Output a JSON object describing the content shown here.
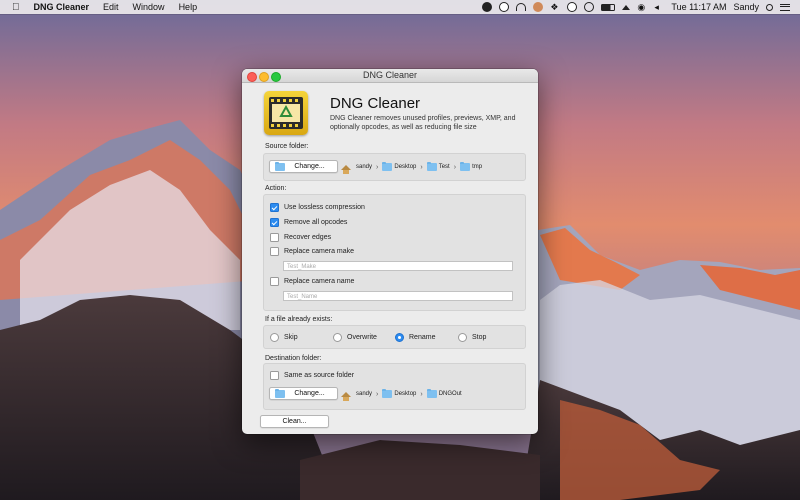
{
  "menubar": {
    "app_name": "DNG Cleaner",
    "menus": [
      "Edit",
      "Window",
      "Help"
    ],
    "time": "Tue 11:17 AM",
    "user": "Sandy",
    "status_icons": [
      "circle-icon",
      "info-icon",
      "headphones-icon",
      "avatar-icon",
      "dropbox-icon",
      "time-machine-icon",
      "timer-icon",
      "battery-icon",
      "eject-icon",
      "wifi-icon",
      "volume-icon"
    ]
  },
  "window": {
    "title": "DNG Cleaner",
    "app_name": "DNG Cleaner",
    "app_description": "DNG Cleaner removes unused profiles, previews, XMP, and optionally opcodes, as well as reducing file size"
  },
  "source": {
    "label": "Source folder:",
    "button": "Change...",
    "path": [
      "sandy",
      "Desktop",
      "Test",
      "tmp"
    ]
  },
  "action": {
    "label": "Action:",
    "options": [
      {
        "label": "Use lossless compression",
        "checked": true
      },
      {
        "label": "Remove all opcodes",
        "checked": true
      },
      {
        "label": "Recover edges",
        "checked": false
      },
      {
        "label": "Replace camera make",
        "checked": false
      },
      {
        "label": "Replace camera name",
        "checked": false
      }
    ],
    "make_placeholder": "Test_Make",
    "name_placeholder": "Test_Name"
  },
  "exists": {
    "label": "If a file already exists:",
    "options": [
      "Skip",
      "Overwrite",
      "Rename",
      "Stop"
    ],
    "selected": "Rename"
  },
  "destination": {
    "label": "Destination folder:",
    "same_as_source": "Same as source folder",
    "button": "Change...",
    "path": [
      "sandy",
      "Desktop",
      "DNGOut"
    ]
  },
  "clean_button": "Clean..."
}
